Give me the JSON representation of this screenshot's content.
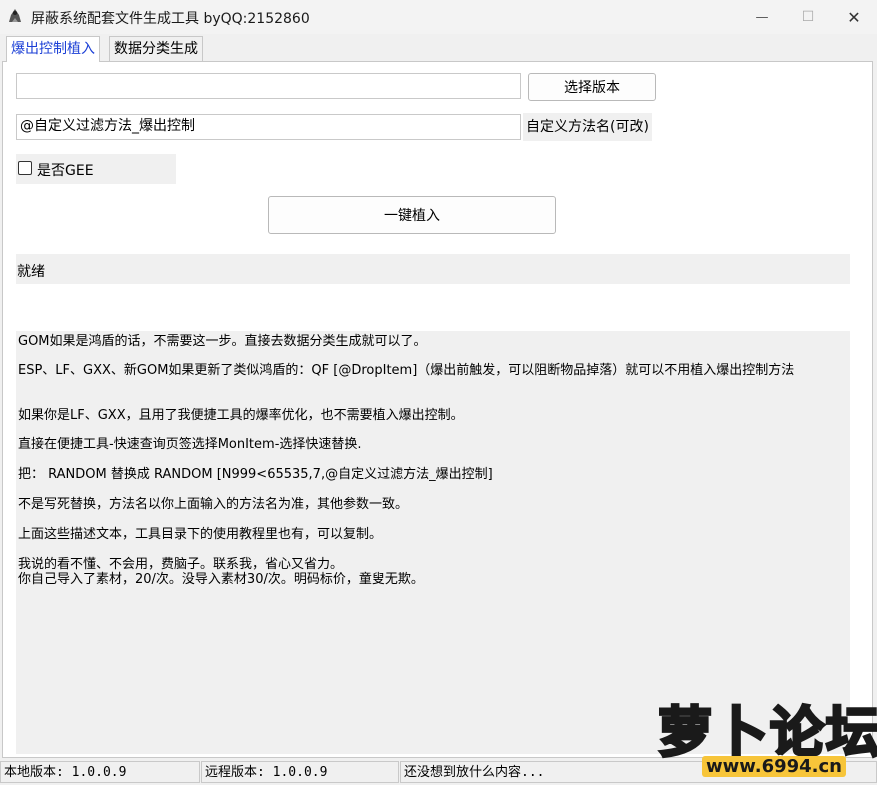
{
  "window": {
    "title": "屏蔽系统配套文件生成工具 byQQ:2152860",
    "minimize_glyph": "—",
    "maximize_glyph": "☐",
    "close_glyph": "✕"
  },
  "tabs": [
    {
      "label": "爆出控制植入",
      "active": true
    },
    {
      "label": "数据分类生成",
      "active": false
    }
  ],
  "form": {
    "version_path_value": "",
    "select_version_label": "选择版本",
    "method_name_value": "@自定义过滤方法_爆出控制",
    "method_name_label": "自定义方法名(可改)",
    "gee_checkbox_label": "是否GEE",
    "gee_checked": false,
    "one_click_label": "一键植入"
  },
  "status": {
    "text": "就绪"
  },
  "description": {
    "lines": [
      "GOM如果是鸿盾的话，不需要这一步。直接去数据分类生成就可以了。",
      "ESP、LF、GXX、新GOM如果更新了类似鸿盾的：QF [@DropItem]（爆出前触发，可以阻断物品掉落）就可以不用植入爆出控制方法",
      "如果你是LF、GXX，且用了我便捷工具的爆率优化，也不需要植入爆出控制。",
      "直接在便捷工具-快速查询页签选择MonItem-选择快速替换.",
      "把： RANDOM 替换成  RANDOM [N999<65535,7,@自定义过滤方法_爆出控制]",
      "不是写死替换，方法名以你上面输入的方法名为准，其他参数一致。",
      "上面这些描述文本，工具目录下的使用教程里也有，可以复制。",
      "我说的看不懂、不会用，费脑子。联系我，省心又省力。",
      "你自己导入了素材，20/次。没导入素材30/次。明码标价，童叟无欺。"
    ]
  },
  "statusbar": {
    "local_version": "本地版本: 1.0.0.9",
    "remote_version": "远程版本: 1.0.0.9",
    "message": "还没想到放什么内容..."
  },
  "watermark": {
    "brand": "萝卜论坛",
    "url": "www.6994.cn"
  },
  "colors": {
    "active_tab_text": "#1b3fd6",
    "window_bg": "#f0f0f0",
    "watermark_fill": "#f7c53a"
  }
}
